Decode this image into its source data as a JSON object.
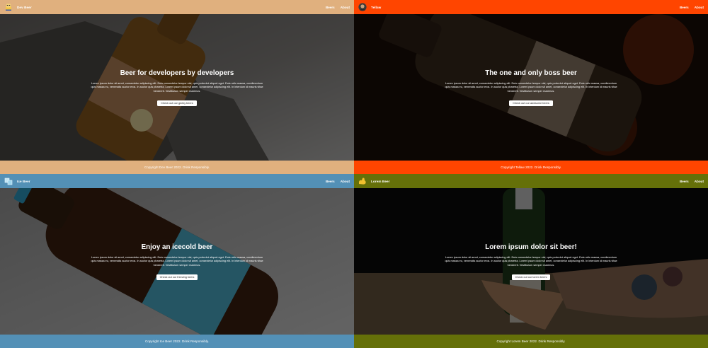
{
  "panels": [
    {
      "brand": "Dev Beer",
      "accent": "#e0b07e",
      "nav": {
        "beers": "Beers",
        "about": "About"
      },
      "hero": {
        "title": "Beer for developers by developers",
        "body": "Lorem ipsum dolor sit amet, consectetur adipiscing elit. Duis consectetur tempor nisl, quis porta dui aliquet eget. Duis odio massa, condimentum quis massa eu, venenatis auctor eros. In auctor quis pharetra, Lorem ipsum dolor sit amet, consectetur adipiscing elit. In interdum id mauris vitae hendrerit. Vestibulum semper maximus.",
        "button": "Check out our geeky beers"
      },
      "footer": "Copyright Dev Beer 2022. Drink Responsibly.",
      "logo_icon": "developer-mascot-icon"
    },
    {
      "brand": "Tellaw",
      "accent": "#ff4500",
      "nav": {
        "beers": "Beers",
        "about": "About"
      },
      "hero": {
        "title": "The one and only boss beer",
        "body": "Lorem ipsum dolor sit amet, consectetur adipiscing elit. Duis consectetur tempor nisl, quis porta dui aliquet eget. Duis odio massa, condimentum quis massa eu, venenatis auctor eros. In auctor quis pharetra, Lorem ipsum dolor sit amet, consectetur adipiscing elit. In interdum id mauris vitae hendrerit. Vestibulum semper maximus.",
        "button": "Check out our awesome beers"
      },
      "footer": "Copyright Tellaw 2022. Drink Responsibly.",
      "logo_icon": "boss-avatar-icon"
    },
    {
      "brand": "Ice Beer",
      "accent": "#5390b6",
      "nav": {
        "beers": "Beers",
        "about": "About"
      },
      "hero": {
        "title": "Enjoy an icecold beer",
        "body": "Lorem ipsum dolor sit amet, consectetur adipiscing elit. Duis consectetur tempor nisl, quis porta dui aliquet eget. Duis odio massa, condimentum quis massa eu, venenatis auctor eros. In auctor quis pharetra, Lorem ipsum dolor sit amet, consectetur adipiscing elit. In interdum id mauris vitae hendrerit. Vestibulum semper maximus.",
        "button": "Check out our freezing beers"
      },
      "footer": "Copyright Ice Beer 2022. Drink Responsibly.",
      "logo_icon": "ice-cube-icon"
    },
    {
      "brand": "Lorem Beer",
      "accent": "#657009",
      "nav": {
        "beers": "Beers",
        "about": "About"
      },
      "hero": {
        "title": "Lorem ipsum dolor sit beer!",
        "body": "Lorem ipsum dolor sit amet, consectetur adipiscing elit. Duis consectetur tempor nisl, quis porta dui aliquet eget. Duis odio massa, condimentum quis massa eu, venenatis auctor eros. In auctor quis pharetra, Lorem ipsum dolor sit amet, consectetur adipiscing elit. In interdum id mauris vitae hendrerit. Vestibulum semper maximus.",
        "button": "Check out our lorem beers"
      },
      "footer": "Copyright Lorem Beer 2022. Drink Responsibly.",
      "logo_icon": "flexed-arm-icon"
    }
  ]
}
